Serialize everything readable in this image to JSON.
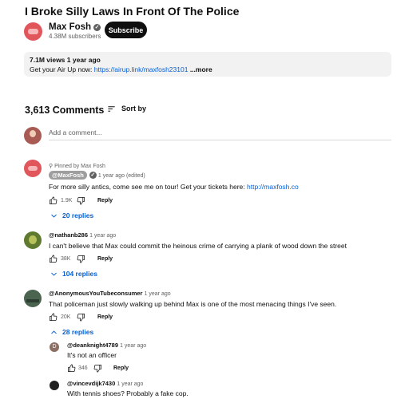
{
  "video": {
    "title": "I Broke Silly Laws In Front Of The Police",
    "channel_name": "Max Fosh",
    "subscribers": "4.38M subscribers",
    "subscribe_label": "Subscribe",
    "views_date": "7.1M views  1 year ago",
    "description_prefix": "Get your Air Up now: ",
    "description_link": "https://airup.link/maxfosh23101",
    "description_more": " ...more"
  },
  "comments_header": {
    "count": "3,613 Comments",
    "sort_label": "Sort by",
    "add_placeholder": "Add a comment..."
  },
  "comments": [
    {
      "pinned_label": "Pinned by Max Fosh",
      "handle": "@MaxFosh",
      "meta": "1 year ago (edited)",
      "text_prefix": "For more silly antics, come see me on tour! Get your tickets here: ",
      "text_link": "http://maxfosh.co",
      "likes": "1.9K",
      "reply_label": "Reply",
      "replies_label": "20 replies"
    },
    {
      "handle": "@nathanb286",
      "meta": "1 year ago",
      "text": "I can't believe that Max could commit the heinous crime of carrying a plank of wood down the street",
      "likes": "38K",
      "reply_label": "Reply",
      "replies_label": "104 replies"
    },
    {
      "handle": "@AnonymousYouTubeconsumer",
      "meta": "1 year ago",
      "text": "That policeman just slowly walking up behind Max is one of the most menacing things I've seen.",
      "likes": "20K",
      "reply_label": "Reply",
      "replies_label": "28 replies",
      "replies": [
        {
          "avatar_letter": "D",
          "handle": "@deanknight4789",
          "meta": "1 year ago",
          "text": "It's not an officer",
          "likes": "346",
          "reply_label": "Reply"
        },
        {
          "handle": "@vincevdijk7430",
          "meta": "1 year ago",
          "text": "With tennis shoes? Probably a fake cop."
        }
      ]
    }
  ],
  "icons": [
    "verified-check-icon",
    "sort-icon",
    "pin-icon",
    "like-icon",
    "dislike-icon",
    "chevron-down-icon",
    "chevron-up-icon"
  ]
}
